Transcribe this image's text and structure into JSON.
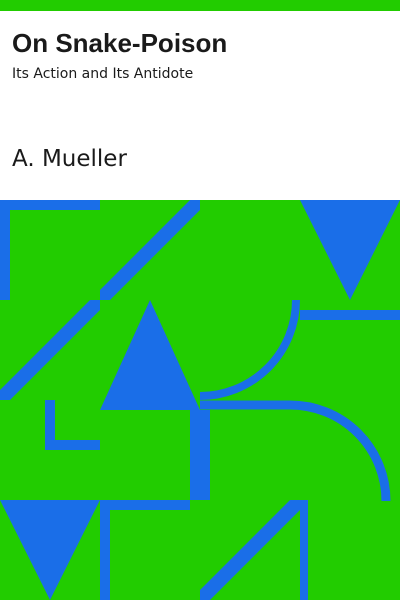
{
  "book": {
    "title": "On Snake-Poison",
    "subtitle": "Its Action and Its Antidote",
    "author": "A. Mueller"
  },
  "colors": {
    "background": "#ffffff",
    "accent_green": "#22cc00",
    "pattern_blue": "#1a6ee8",
    "text": "#1a1a1a"
  }
}
